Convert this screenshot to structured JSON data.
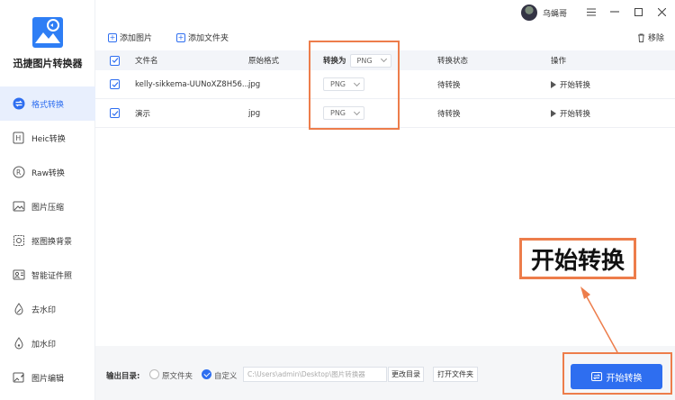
{
  "app": {
    "title": "迅捷图片转换器"
  },
  "sidebar": {
    "items": [
      {
        "label": "格式转换",
        "icon": "format-convert-icon",
        "active": true
      },
      {
        "label": "Heic转换",
        "icon": "heic-icon"
      },
      {
        "label": "Raw转换",
        "icon": "raw-icon"
      },
      {
        "label": "图片压缩",
        "icon": "compress-icon"
      },
      {
        "label": "抠图换背景",
        "icon": "cutout-icon"
      },
      {
        "label": "智能证件照",
        "icon": "id-photo-icon"
      },
      {
        "label": "去水印",
        "icon": "remove-watermark-icon"
      },
      {
        "label": "加水印",
        "icon": "add-watermark-icon"
      },
      {
        "label": "图片编辑",
        "icon": "image-edit-icon"
      }
    ]
  },
  "topbar": {
    "username": "乌蝇哥"
  },
  "toolbar": {
    "add_image": "添加图片",
    "add_folder": "添加文件夹",
    "remove": "移除"
  },
  "table": {
    "headers": {
      "filename": "文件名",
      "original_format": "原始格式",
      "convert_to": "转换为",
      "convert_to_value": "PNG",
      "status": "转换状态",
      "action": "操作"
    },
    "rows": [
      {
        "filename": "kelly-sikkema-UUNoXZ8H56...",
        "format": "jpg",
        "target": "PNG",
        "status": "待转换",
        "action": "开始转换"
      },
      {
        "filename": "演示",
        "format": "jpg",
        "target": "PNG",
        "status": "待转换",
        "action": "开始转换"
      }
    ]
  },
  "bottom": {
    "output_label": "输出目录:",
    "option_source": "原文件夹",
    "option_custom": "自定义",
    "path": "C:\\Users\\admin\\Desktop\\图片转换器",
    "change_dir": "更改目录",
    "open_folder": "打开文件夹",
    "start": "开始转换"
  },
  "annotation": {
    "callout": "开始转换",
    "color": "#ed7d4b"
  },
  "colors": {
    "accent": "#2e6ef0",
    "annotation": "#ed7d4b"
  }
}
